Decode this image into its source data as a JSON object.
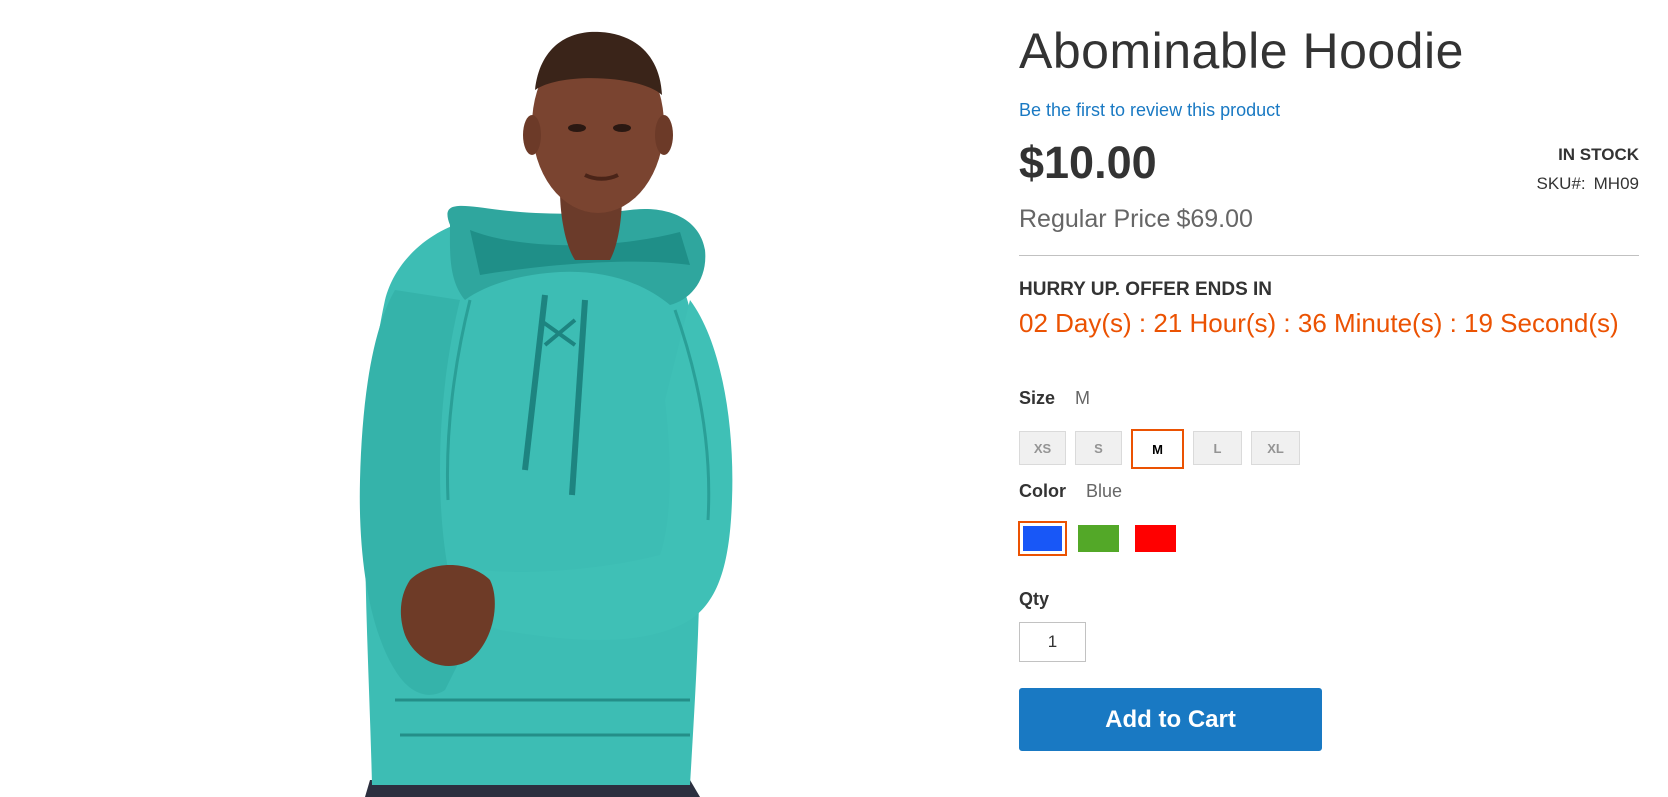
{
  "product": {
    "title": "Abominable Hoodie",
    "review_link": "Be the first to review this product",
    "price": "$10.00",
    "stock_status": "IN STOCK",
    "sku_label": "SKU#:",
    "sku_value": "MH09",
    "regular_price_label": "Regular Price",
    "regular_price_value": "$69.00"
  },
  "offer": {
    "heading": "HURRY UP. OFFER ENDS IN",
    "countdown": "02 Day(s) : 21 Hour(s) : 36 Minute(s) : 19 Second(s)"
  },
  "size": {
    "label": "Size",
    "selected": "M",
    "options": [
      "XS",
      "S",
      "M",
      "L",
      "XL"
    ]
  },
  "color": {
    "label": "Color",
    "selected": "Blue",
    "options": [
      {
        "name": "Blue",
        "hex": "#1857f7"
      },
      {
        "name": "Green",
        "hex": "#53a828"
      },
      {
        "name": "Red",
        "hex": "#ff0000"
      }
    ]
  },
  "qty": {
    "label": "Qty",
    "value": "1"
  },
  "cart": {
    "add_label": "Add to Cart"
  },
  "colors": {
    "accent": "#eb5202",
    "link": "#1979c3",
    "hoodie": "#3dbdb4"
  }
}
